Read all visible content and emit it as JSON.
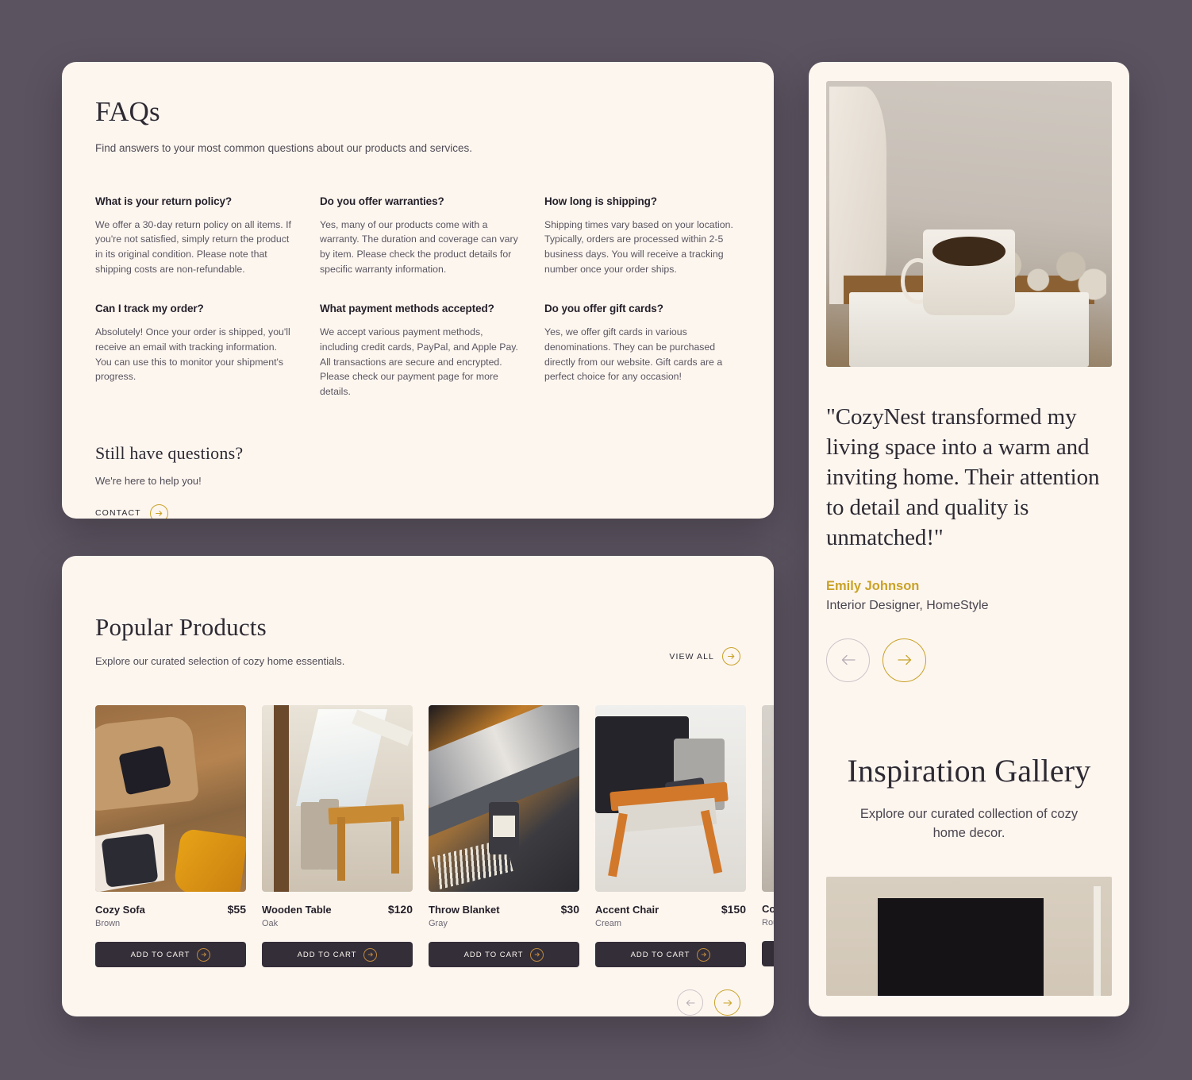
{
  "theme": {
    "background": "#5b5360",
    "panel": "#fdf6ef",
    "accent_gold": "#c9a227",
    "dark": "#332e38",
    "muted_arrow": "#cdc4c9"
  },
  "faq": {
    "title": "FAQs",
    "subtitle": "Find answers to your most common questions about our products and services.",
    "items": [
      {
        "question": "What is your return policy?",
        "answer": "We offer a 30-day return policy on all items. If you're not satisfied, simply return the product in its original condition. Please note that shipping costs are non-refundable."
      },
      {
        "question": "Do you offer warranties?",
        "answer": "Yes, many of our products come with a warranty. The duration and coverage can vary by item. Please check the product details for specific warranty information."
      },
      {
        "question": "How long is shipping?",
        "answer": "Shipping times vary based on your location. Typically, orders are processed within 2-5 business days. You will receive a tracking number once your order ships."
      },
      {
        "question": "Can I track my order?",
        "answer": "Absolutely! Once your order is shipped, you'll receive an email with tracking information. You can use this to monitor your shipment's progress."
      },
      {
        "question": "What payment methods accepted?",
        "answer": "We accept various payment methods, including credit cards, PayPal, and Apple Pay. All transactions are secure and encrypted. Please check our payment page for more details."
      },
      {
        "question": "Do you offer gift cards?",
        "answer": "Yes, we offer gift cards in various denominations. They can be purchased directly from our website. Gift cards are a perfect choice for any occasion!"
      }
    ],
    "still": {
      "title": "Still have questions?",
      "subtitle": "We're here to help you!",
      "cta_label": "CONTACT",
      "cta_icon": "arrow-right-circle-icon"
    }
  },
  "products": {
    "title": "Popular Products",
    "subtitle": "Explore our curated selection of cozy home essentials.",
    "view_all_label": "VIEW ALL",
    "view_all_icon": "arrow-right-circle-icon",
    "add_to_cart_label": "ADD TO CART",
    "items": [
      {
        "name": "Cozy Sofa",
        "variant": "Brown",
        "price": "$55",
        "image": "sofa-photo"
      },
      {
        "name": "Wooden Table",
        "variant": "Oak",
        "price": "$120",
        "image": "attic-dining-photo"
      },
      {
        "name": "Throw Blanket",
        "variant": "Gray",
        "price": "$30",
        "image": "blanket-candle-photo"
      },
      {
        "name": "Accent Chair",
        "variant": "Cream",
        "price": "$150",
        "image": "accent-chair-photo"
      },
      {
        "name": "Cof",
        "variant": "Roun",
        "price": "",
        "image": "coffee-table-photo"
      }
    ],
    "nav": {
      "prev_icon": "arrow-left-circle-icon",
      "next_icon": "arrow-right-circle-icon"
    }
  },
  "testimonial": {
    "image": "coffee-mug-book-photo",
    "quote": "\"CozyNest transformed my living space into a warm and inviting home. Their attention to detail and quality is unmatched!\"",
    "author_name": "Emily Johnson",
    "author_role": "Interior Designer, HomeStyle",
    "nav": {
      "prev_icon": "arrow-left-circle-icon",
      "next_icon": "arrow-right-circle-icon"
    }
  },
  "gallery": {
    "title": "Inspiration Gallery",
    "subtitle": "Explore our curated collection of cozy home decor.",
    "image": "framed-art-wall-photo"
  }
}
